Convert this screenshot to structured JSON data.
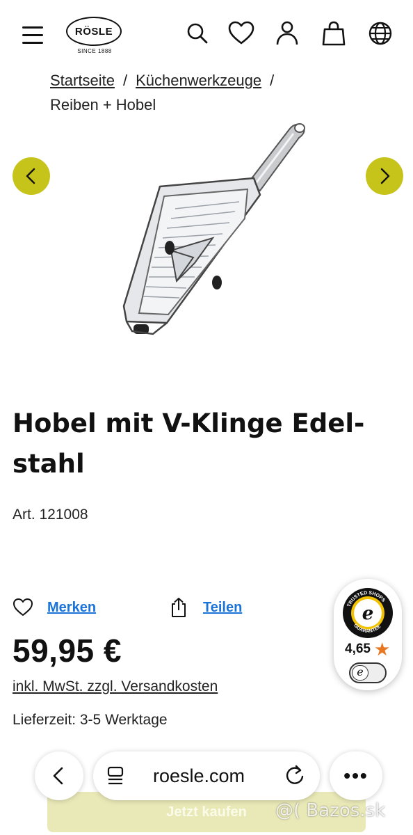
{
  "header": {
    "logo_name": "RÖSLE",
    "logo_tagline": "SINCE 1888",
    "icons": [
      "search-icon",
      "heart-icon",
      "user-icon",
      "bag-icon",
      "globe-icon"
    ]
  },
  "breadcrumb": {
    "items": [
      "Startseite",
      "Küchenwerkzeuge"
    ],
    "separator": "/",
    "current": "Reiben + Hobel"
  },
  "product": {
    "title": "Hobel mit V-Klinge Edel-stahl",
    "article_label": "Art. 121008",
    "price": "59,95 €",
    "vat_note": "inkl. MwSt. zzgl. Versandkosten",
    "delivery": "Lieferzeit: 3-5 Werktage",
    "buy_label": "Jetzt kaufen"
  },
  "actions": {
    "merken": "Merken",
    "teilen": "Teilen"
  },
  "trusted_shops": {
    "badge_text": "TRUSTED SHOPS GUARANTEE",
    "rating": "4,65",
    "toggle_letter": "e"
  },
  "browser": {
    "url": "roesle.com",
    "more": "•••"
  },
  "watermark": "@( Bazos.sk",
  "colors": {
    "accent": "#c6c31a",
    "link": "#1a73d9",
    "star": "#e87722",
    "buy_button": "#e9e9b8"
  }
}
